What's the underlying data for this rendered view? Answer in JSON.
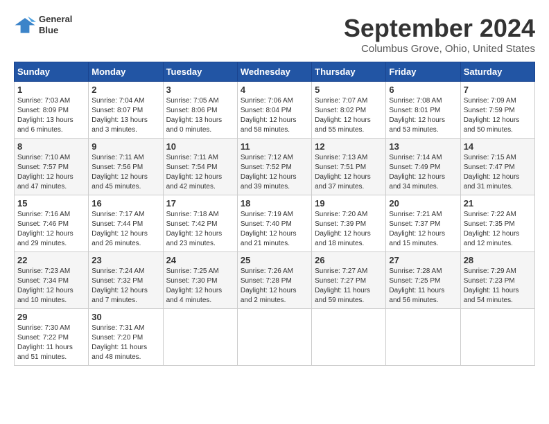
{
  "header": {
    "logo_line1": "General",
    "logo_line2": "Blue",
    "month_title": "September 2024",
    "location": "Columbus Grove, Ohio, United States"
  },
  "days_of_week": [
    "Sunday",
    "Monday",
    "Tuesday",
    "Wednesday",
    "Thursday",
    "Friday",
    "Saturday"
  ],
  "weeks": [
    [
      {
        "day": "1",
        "info": "Sunrise: 7:03 AM\nSunset: 8:09 PM\nDaylight: 13 hours\nand 6 minutes."
      },
      {
        "day": "2",
        "info": "Sunrise: 7:04 AM\nSunset: 8:07 PM\nDaylight: 13 hours\nand 3 minutes."
      },
      {
        "day": "3",
        "info": "Sunrise: 7:05 AM\nSunset: 8:06 PM\nDaylight: 13 hours\nand 0 minutes."
      },
      {
        "day": "4",
        "info": "Sunrise: 7:06 AM\nSunset: 8:04 PM\nDaylight: 12 hours\nand 58 minutes."
      },
      {
        "day": "5",
        "info": "Sunrise: 7:07 AM\nSunset: 8:02 PM\nDaylight: 12 hours\nand 55 minutes."
      },
      {
        "day": "6",
        "info": "Sunrise: 7:08 AM\nSunset: 8:01 PM\nDaylight: 12 hours\nand 53 minutes."
      },
      {
        "day": "7",
        "info": "Sunrise: 7:09 AM\nSunset: 7:59 PM\nDaylight: 12 hours\nand 50 minutes."
      }
    ],
    [
      {
        "day": "8",
        "info": "Sunrise: 7:10 AM\nSunset: 7:57 PM\nDaylight: 12 hours\nand 47 minutes."
      },
      {
        "day": "9",
        "info": "Sunrise: 7:11 AM\nSunset: 7:56 PM\nDaylight: 12 hours\nand 45 minutes."
      },
      {
        "day": "10",
        "info": "Sunrise: 7:11 AM\nSunset: 7:54 PM\nDaylight: 12 hours\nand 42 minutes."
      },
      {
        "day": "11",
        "info": "Sunrise: 7:12 AM\nSunset: 7:52 PM\nDaylight: 12 hours\nand 39 minutes."
      },
      {
        "day": "12",
        "info": "Sunrise: 7:13 AM\nSunset: 7:51 PM\nDaylight: 12 hours\nand 37 minutes."
      },
      {
        "day": "13",
        "info": "Sunrise: 7:14 AM\nSunset: 7:49 PM\nDaylight: 12 hours\nand 34 minutes."
      },
      {
        "day": "14",
        "info": "Sunrise: 7:15 AM\nSunset: 7:47 PM\nDaylight: 12 hours\nand 31 minutes."
      }
    ],
    [
      {
        "day": "15",
        "info": "Sunrise: 7:16 AM\nSunset: 7:46 PM\nDaylight: 12 hours\nand 29 minutes."
      },
      {
        "day": "16",
        "info": "Sunrise: 7:17 AM\nSunset: 7:44 PM\nDaylight: 12 hours\nand 26 minutes."
      },
      {
        "day": "17",
        "info": "Sunrise: 7:18 AM\nSunset: 7:42 PM\nDaylight: 12 hours\nand 23 minutes."
      },
      {
        "day": "18",
        "info": "Sunrise: 7:19 AM\nSunset: 7:40 PM\nDaylight: 12 hours\nand 21 minutes."
      },
      {
        "day": "19",
        "info": "Sunrise: 7:20 AM\nSunset: 7:39 PM\nDaylight: 12 hours\nand 18 minutes."
      },
      {
        "day": "20",
        "info": "Sunrise: 7:21 AM\nSunset: 7:37 PM\nDaylight: 12 hours\nand 15 minutes."
      },
      {
        "day": "21",
        "info": "Sunrise: 7:22 AM\nSunset: 7:35 PM\nDaylight: 12 hours\nand 12 minutes."
      }
    ],
    [
      {
        "day": "22",
        "info": "Sunrise: 7:23 AM\nSunset: 7:34 PM\nDaylight: 12 hours\nand 10 minutes."
      },
      {
        "day": "23",
        "info": "Sunrise: 7:24 AM\nSunset: 7:32 PM\nDaylight: 12 hours\nand 7 minutes."
      },
      {
        "day": "24",
        "info": "Sunrise: 7:25 AM\nSunset: 7:30 PM\nDaylight: 12 hours\nand 4 minutes."
      },
      {
        "day": "25",
        "info": "Sunrise: 7:26 AM\nSunset: 7:28 PM\nDaylight: 12 hours\nand 2 minutes."
      },
      {
        "day": "26",
        "info": "Sunrise: 7:27 AM\nSunset: 7:27 PM\nDaylight: 11 hours\nand 59 minutes."
      },
      {
        "day": "27",
        "info": "Sunrise: 7:28 AM\nSunset: 7:25 PM\nDaylight: 11 hours\nand 56 minutes."
      },
      {
        "day": "28",
        "info": "Sunrise: 7:29 AM\nSunset: 7:23 PM\nDaylight: 11 hours\nand 54 minutes."
      }
    ],
    [
      {
        "day": "29",
        "info": "Sunrise: 7:30 AM\nSunset: 7:22 PM\nDaylight: 11 hours\nand 51 minutes."
      },
      {
        "day": "30",
        "info": "Sunrise: 7:31 AM\nSunset: 7:20 PM\nDaylight: 11 hours\nand 48 minutes."
      },
      {
        "day": "",
        "info": ""
      },
      {
        "day": "",
        "info": ""
      },
      {
        "day": "",
        "info": ""
      },
      {
        "day": "",
        "info": ""
      },
      {
        "day": "",
        "info": ""
      }
    ]
  ]
}
